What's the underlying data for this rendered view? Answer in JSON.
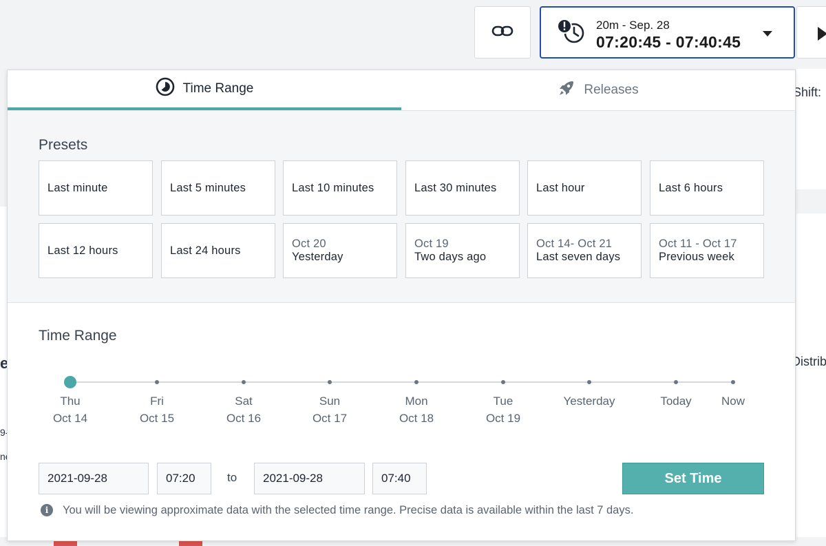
{
  "toolbar": {
    "time_sub": "20m - Sep. 28",
    "time_main": "07:20:45 - 07:40:45"
  },
  "background": {
    "shift_label": "Shift:",
    "distrib_label": "Distrib",
    "e_label": "e",
    "frag1": "9-",
    "frag2": "ne"
  },
  "tabs": [
    {
      "label": "Time Range",
      "icon": "time-range-icon",
      "active": true
    },
    {
      "label": "Releases",
      "icon": "rocket-icon",
      "active": false
    }
  ],
  "presets": {
    "title": "Presets",
    "items": [
      {
        "label": "Last minute",
        "date": ""
      },
      {
        "label": "Last 5 minutes",
        "date": ""
      },
      {
        "label": "Last 10 minutes",
        "date": ""
      },
      {
        "label": "Last 30 minutes",
        "date": ""
      },
      {
        "label": "Last hour",
        "date": ""
      },
      {
        "label": "Last 6 hours",
        "date": ""
      },
      {
        "label": "Last 12 hours",
        "date": ""
      },
      {
        "label": "Last 24 hours",
        "date": ""
      },
      {
        "label": "Yesterday",
        "date": "Oct 20"
      },
      {
        "label": "Two days ago",
        "date": "Oct 19"
      },
      {
        "label": "Last seven days",
        "date": "Oct 14- Oct 21"
      },
      {
        "label": "Previous week",
        "date": "Oct 11 - Oct 17"
      }
    ]
  },
  "range": {
    "title": "Time Range",
    "timeline": [
      {
        "day": "Thu",
        "date": "Oct 14",
        "selected": true
      },
      {
        "day": "Fri",
        "date": "Oct 15",
        "selected": false
      },
      {
        "day": "Sat",
        "date": "Oct 16",
        "selected": false
      },
      {
        "day": "Sun",
        "date": "Oct 17",
        "selected": false
      },
      {
        "day": "Mon",
        "date": "Oct 18",
        "selected": false
      },
      {
        "day": "Tue",
        "date": "Oct 19",
        "selected": false
      },
      {
        "day": "Yesterday",
        "date": "",
        "selected": false
      },
      {
        "day": "Today",
        "date": "",
        "selected": false
      },
      {
        "day": "Now",
        "date": "",
        "selected": false
      }
    ],
    "start_date": "2021-09-28",
    "start_time": "07:20",
    "to_label": "to",
    "end_date": "2021-09-28",
    "end_time": "07:40",
    "set_button": "Set Time",
    "info": "You will be viewing approximate data with the selected time range. Precise data is available within the last 7 days."
  },
  "colors": {
    "accent": "#4aa8a8",
    "button": "#53b0ad",
    "border_active": "#1f4db3"
  }
}
